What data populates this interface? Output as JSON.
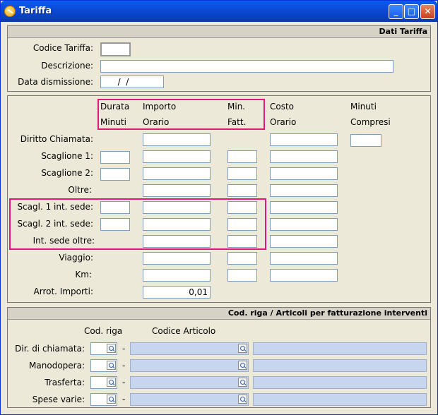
{
  "window": {
    "title": "Tariffa"
  },
  "section1": {
    "header": "Dati Tariffa",
    "codice_label": "Codice Tariffa:",
    "codice_value": "",
    "descrizione_label": "Descrizione:",
    "descrizione_value": "",
    "data_label": "Data dismissione:",
    "data_value": "  /  /"
  },
  "section2": {
    "headers": {
      "durata": "Durata",
      "minuti": "Minuti",
      "importo": "Importo",
      "orario": "Orario",
      "min": "Min.",
      "fatt": "Fatt.",
      "costo": "Costo",
      "costo_orario": "Orario",
      "minuti_h": "Minuti",
      "compresi": "Compresi"
    },
    "rows": {
      "diritto": "Diritto Chiamata:",
      "scaglione1": "Scaglione 1:",
      "scaglione2": "Scaglione 2:",
      "oltre": "Oltre:",
      "scagl1_int": "Scagl. 1 int. sede:",
      "scagl2_int": "Scagl. 2 int. sede:",
      "int_oltre": "Int. sede oltre:",
      "viaggio": "Viaggio:",
      "km": "Km:",
      "arrot": "Arrot. Importi:"
    },
    "arrot_value": "0,01"
  },
  "section3": {
    "header": "Cod. riga / Articoli per fatturazione interventi",
    "col_cod_riga": "Cod. riga",
    "col_codice_articolo": "Codice Articolo",
    "dash": "-",
    "rows": {
      "dir": "Dir. di chiamata:",
      "mano": "Manodopera:",
      "trasf": "Trasferta:",
      "spese": "Spese varie:"
    }
  }
}
